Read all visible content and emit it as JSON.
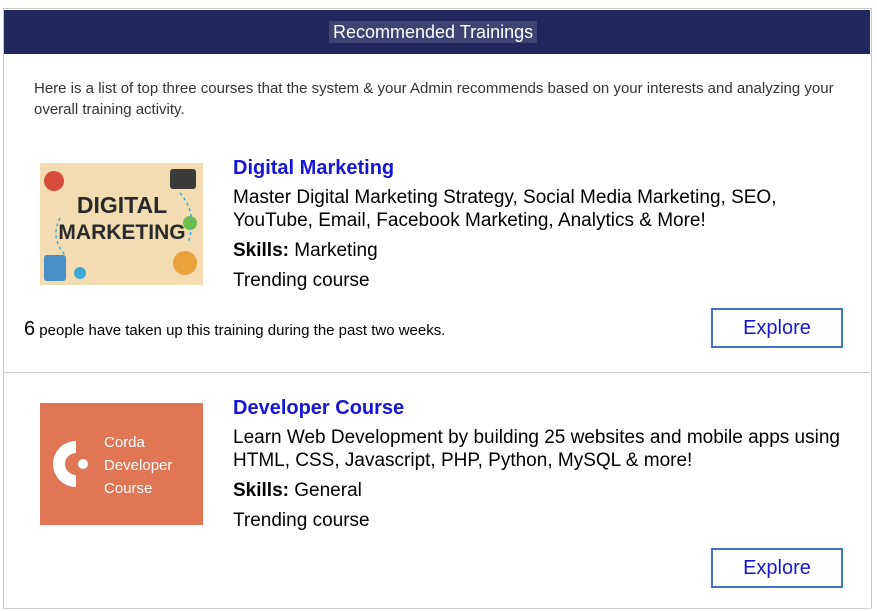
{
  "header": {
    "title": "Recommended Trainings"
  },
  "intro": "Here is a list of top three courses that the system & your Admin recommends based on your interests and analyzing your overall training activity.",
  "courses": [
    {
      "title": "Digital Marketing",
      "description": "Master Digital Marketing Strategy, Social Media Marketing, SEO, YouTube, Email, Facebook Marketing, Analytics & More!",
      "skills_label": "Skills:",
      "skills_value": "Marketing",
      "tag": "Trending course",
      "image_text_1": "DIGITAL",
      "image_text_2": "MARKETING",
      "taken_count": "6",
      "taken_text": "people have taken up this training during the past two weeks.",
      "explore_label": "Explore"
    },
    {
      "title": "Developer Course",
      "description": "Learn Web Development by building 25 websites and mobile apps using HTML, CSS, Javascript, PHP, Python, MySQL & more!",
      "skills_label": "Skills:",
      "skills_value": "General",
      "tag": "Trending course",
      "image_text_1": "Corda",
      "image_text_2": "Developer",
      "image_text_3": "Course",
      "explore_label": "Explore"
    }
  ],
  "colors": {
    "header_bg": "#20275d",
    "title_link": "#1515d8",
    "button_border": "#4572c4",
    "dev_thumb_bg": "#e07656"
  }
}
